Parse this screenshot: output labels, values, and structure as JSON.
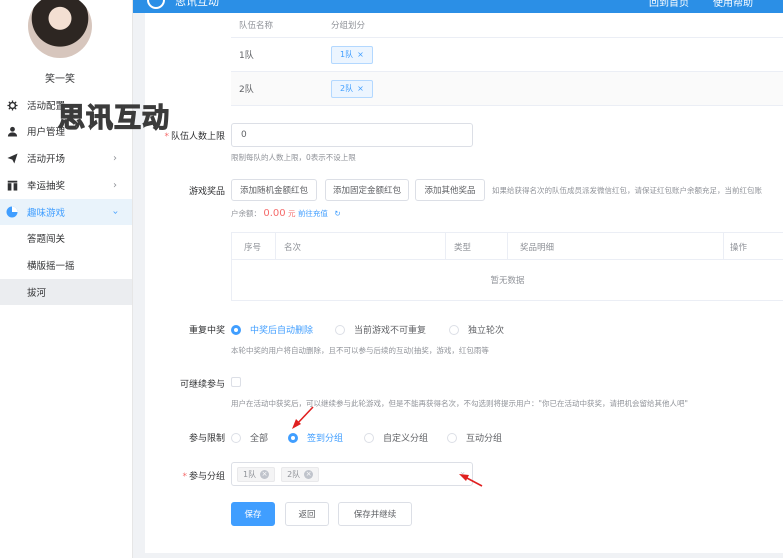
{
  "topbar": {
    "brand": "思讯互动",
    "link_home": "回到首页",
    "link_help": "使用帮助"
  },
  "sidebar": {
    "username": "笑一笑",
    "watermark": "思讯互动",
    "items": [
      {
        "label": "活动配置",
        "icon": "gear-icon"
      },
      {
        "label": "用户管理",
        "icon": "user-icon"
      },
      {
        "label": "活动开场",
        "icon": "send-icon"
      },
      {
        "label": "幸运抽奖",
        "icon": "gift-icon"
      },
      {
        "label": "趣味游戏",
        "icon": "game-icon"
      }
    ],
    "sub_items": [
      "答题闯关",
      "横版摇一摇",
      "拔河"
    ]
  },
  "team_table": {
    "headers": [
      "队伍名称",
      "分组划分"
    ],
    "rows": [
      {
        "name": "1队",
        "tag": "1队"
      },
      {
        "name": "2队",
        "tag": "2队"
      }
    ]
  },
  "max_team": {
    "label": "队伍人数上限",
    "value": "0",
    "hint": "限制每队的人数上限，0表示不设上限"
  },
  "prize": {
    "label": "游戏奖品",
    "buttons": [
      "添加随机金额红包",
      "添加固定金额红包",
      "添加其他奖品"
    ],
    "note": "如果给获得名次的队伍成员派发微信红包，请保证红包账户余额充足，当前红包账",
    "balance_prefix": "户余额：",
    "balance_amount": "0.00",
    "balance_unit": "元",
    "recharge_link": "前往充值",
    "headers": [
      "序号",
      "名次",
      "类型",
      "奖品明细",
      "操作"
    ],
    "empty": "暂无数据"
  },
  "repeat": {
    "label": "重复中奖",
    "options": [
      "中奖后自动删除",
      "当前游戏不可重复",
      "独立轮次"
    ],
    "selected": 0,
    "hint": "本轮中奖的用户将自动删除，且不可以参与后续的互动(抽奖，游戏，红包雨等"
  },
  "continue": {
    "label": "可继续参与",
    "hint": "用户在活动中获奖后，可以继续参与此轮游戏，但是不能再获得名次，不勾选则将提示用户：\"你已在活动中获奖，请把机会留给其他人吧\""
  },
  "limit": {
    "label": "参与限制",
    "options": [
      "全部",
      "签到分组",
      "自定义分组",
      "互动分组"
    ],
    "selected": 1
  },
  "group": {
    "label": "参与分组",
    "chips": [
      "1队",
      "2队"
    ]
  },
  "actions": {
    "save": "保存",
    "back": "返回",
    "save_continue": "保存并继续"
  },
  "colors": {
    "primary": "#409eff",
    "danger": "#f56c6c",
    "topbar": "#2b8fe6",
    "annotation_arrow": "#e02020"
  }
}
